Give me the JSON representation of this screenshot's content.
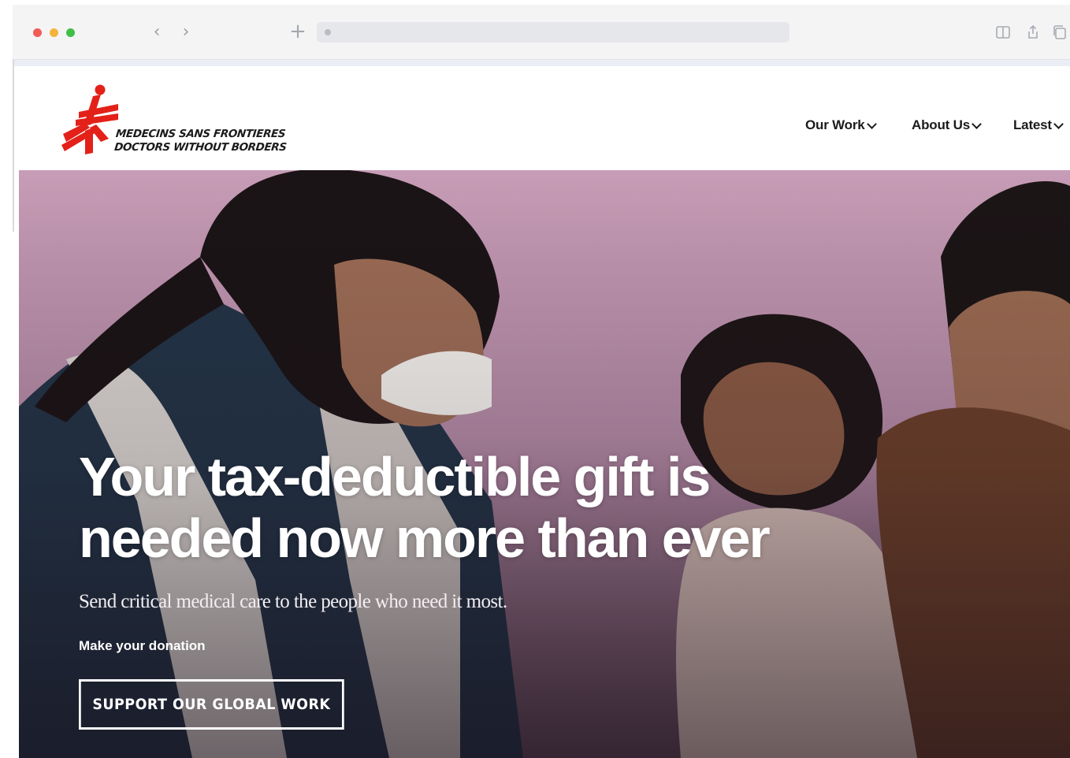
{
  "browser": {
    "nav_back_glyph": "‹",
    "nav_forward_glyph": "›",
    "new_tab_glyph": "+",
    "icons": [
      "reader-icon",
      "share-icon",
      "tabs-icon"
    ]
  },
  "site": {
    "logo": {
      "line1": "MEDECINS SANS FRONTIERES",
      "line2": "DOCTORS WITHOUT BORDERS",
      "brand_color": "#e32119"
    },
    "nav": [
      {
        "label": "Our Work"
      },
      {
        "label": "About Us"
      },
      {
        "label": "Latest"
      }
    ]
  },
  "hero": {
    "headline_line1": "Your tax-deductible gift is",
    "headline_line2": "needed now more than ever",
    "subhead": "Send critical medical care to the people who need it most.",
    "cta_label": "Make your donation",
    "cta_button": "SUPPORT OUR GLOBAL WORK"
  },
  "colors": {
    "accent": "#e32119",
    "hero_tint": "#b08aa3"
  }
}
